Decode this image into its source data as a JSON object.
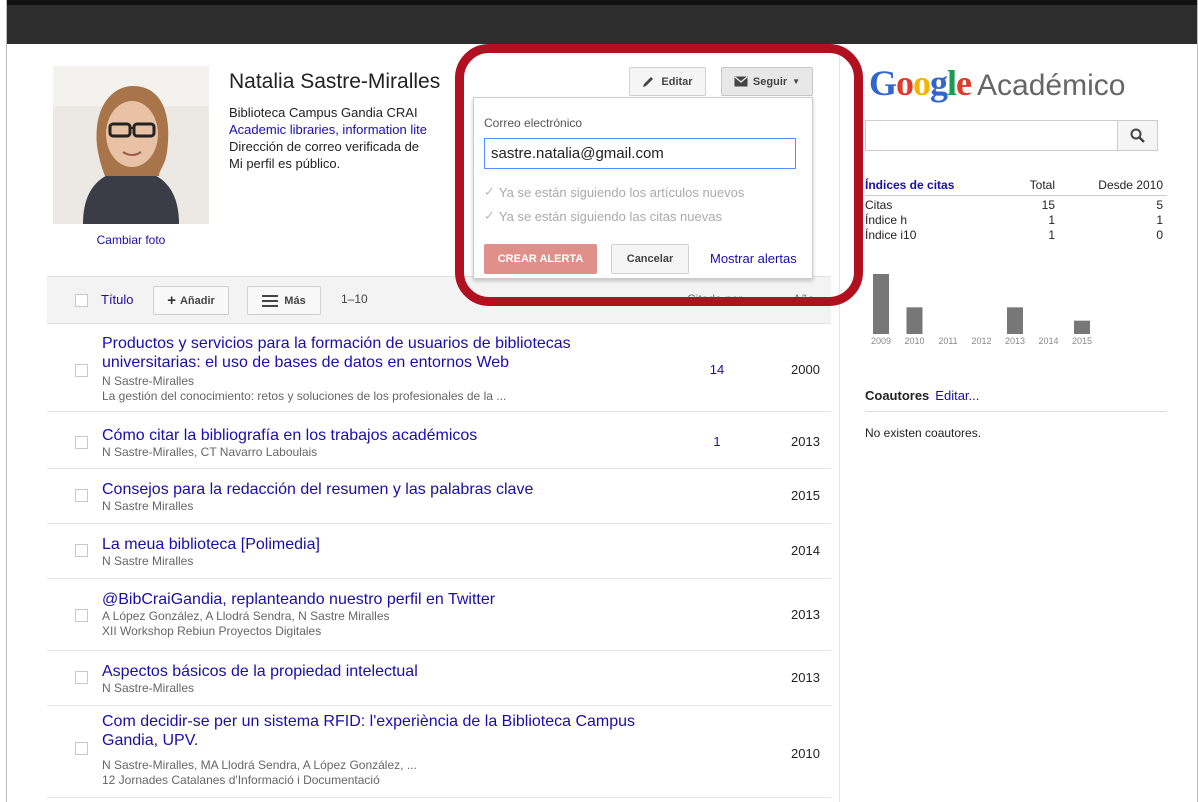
{
  "profile": {
    "name": "Natalia Sastre-Miralles",
    "affiliation": "Biblioteca Campus Gandia CRAI",
    "interests": "Academic libraries, information lite",
    "email_verified": "Dirección de correo verificada de",
    "public": "Mi perfil es público.",
    "change_photo": "Cambiar foto"
  },
  "header": {
    "edit_label": "Editar",
    "follow_label": "Seguir"
  },
  "follow_dropdown": {
    "email_label": "Correo electrónico",
    "email_value": "sastre.natalia@gmail.com",
    "check_articles": "Ya se están siguiendo los artículos nuevos",
    "check_citations": "Ya se están siguiendo las citas nuevas",
    "create_label": "CREAR ALERTA",
    "cancel_label": "Cancelar",
    "show_alerts_label": "Mostrar alertas"
  },
  "table": {
    "title_header": "Título",
    "add_label": "Añadir",
    "more_label": "Más",
    "range": "1–10",
    "cited_header": "Citado por",
    "year_header": "Año",
    "rows": [
      {
        "title": "Productos y servicios para la formación de usuarios de bibliotecas universitarias: el uso de bases de datos en entornos Web",
        "authors": "N Sastre-Miralles",
        "venue": "La gestión del conocimiento: retos y soluciones de los profesionales de la ...",
        "cited": "14",
        "year": "2000"
      },
      {
        "title": "Cómo citar la bibliografía en los trabajos académicos",
        "authors": "N Sastre-Miralles, CT Navarro Laboulais",
        "venue": "",
        "cited": "1",
        "year": "2013"
      },
      {
        "title": "Consejos para la redacción del resumen y las palabras clave",
        "authors": "N Sastre Miralles",
        "venue": "",
        "cited": "",
        "year": "2015"
      },
      {
        "title": "La meua biblioteca [Polimedia]",
        "authors": "N Sastre Miralles",
        "venue": "",
        "cited": "",
        "year": "2014"
      },
      {
        "title": "@BibCraiGandia, replanteando nuestro perfil en Twitter",
        "authors": "A López González, A Llodrá Sendra, N Sastre Miralles",
        "venue": "XII Workshop Rebiun Proyectos Digitales",
        "cited": "",
        "year": "2013"
      },
      {
        "title": "Aspectos básicos de la propiedad intelectual",
        "authors": "N Sastre-Miralles",
        "venue": "",
        "cited": "",
        "year": "2013"
      },
      {
        "title": "Com decidir-se per un sistema RFID: l'experiència de la Biblioteca Campus Gandia, UPV.",
        "authors": "N Sastre-Miralles, MA Llodrá Sendra, A López González, ...",
        "venue": "12 Jornades Catalanes d'Informació i Documentació",
        "cited": "",
        "year": "2010"
      }
    ]
  },
  "sidebar": {
    "logo_google": "Google",
    "logo_academico": "Académico",
    "citations": {
      "header": [
        "Índices de citas",
        "Total",
        "Desde 2010"
      ],
      "rows": [
        [
          "Citas",
          "15",
          "5"
        ],
        [
          "Índice h",
          "1",
          "1"
        ],
        [
          "Índice i10",
          "1",
          "0"
        ]
      ]
    },
    "coauthors_title": "Coautores",
    "coauthors_edit": "Editar...",
    "no_coauthors": "No existen coautores."
  },
  "colors": {
    "link": "#1a0dab",
    "highlight": "#b01020",
    "create_button": "#e0908a"
  },
  "chart_data": {
    "type": "bar",
    "categories": [
      "2009",
      "2010",
      "2011",
      "2012",
      "2013",
      "2014",
      "2015"
    ],
    "values": [
      9,
      4,
      0,
      0,
      4,
      0,
      2
    ],
    "ylim": [
      0,
      9
    ],
    "grid": false
  }
}
